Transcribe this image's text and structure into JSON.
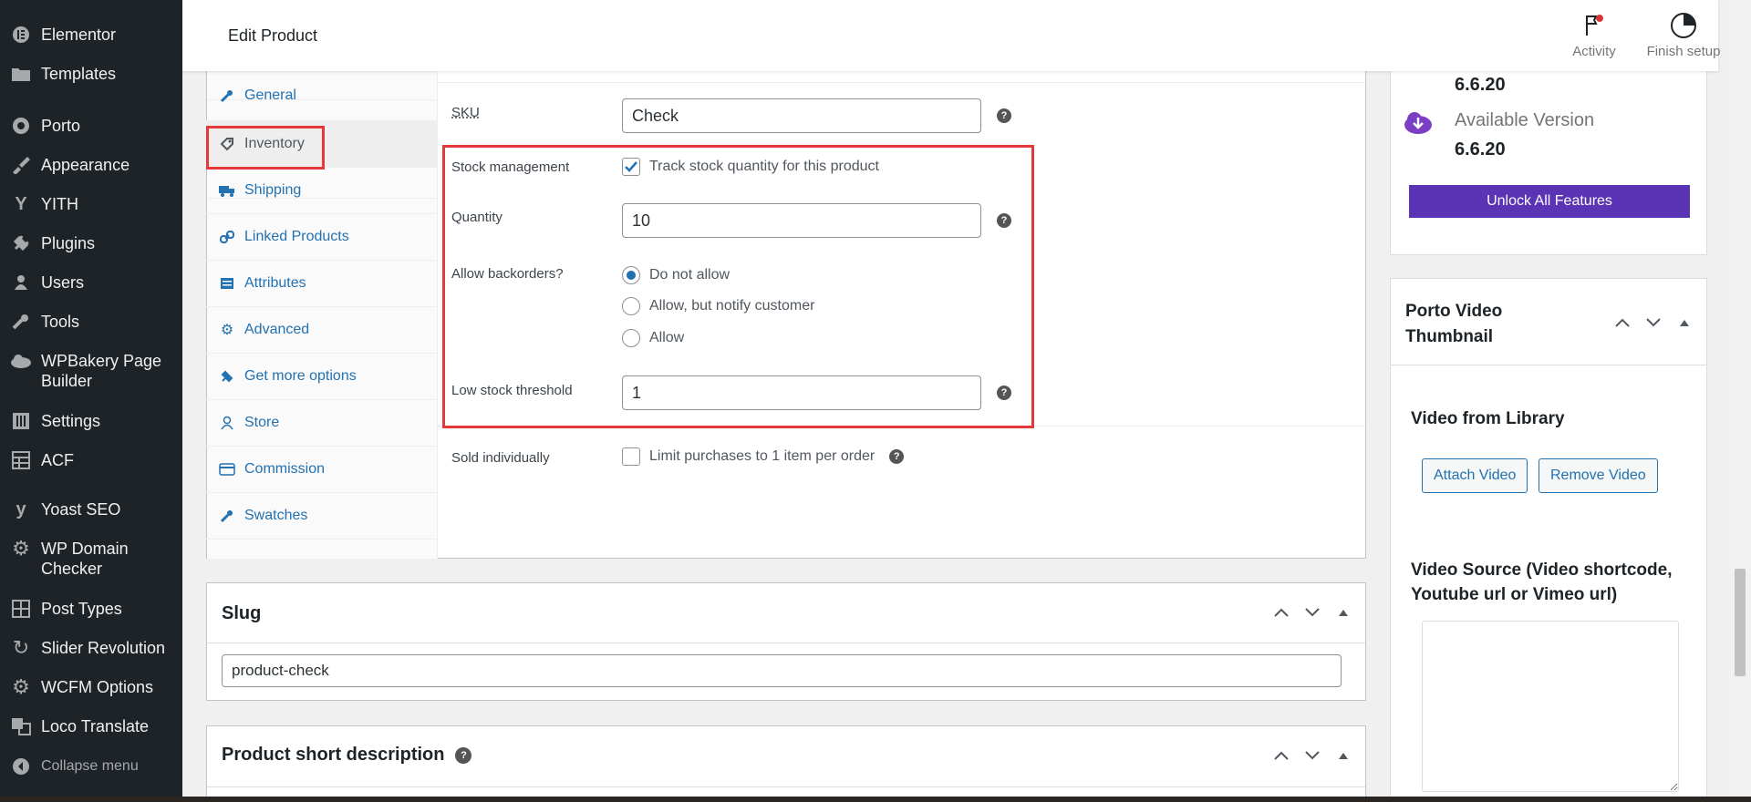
{
  "sidebar": {
    "items": [
      {
        "label": "Elementor",
        "icon": "elementor-icon"
      },
      {
        "label": "Templates",
        "icon": "folder-icon"
      },
      {
        "label": "Porto",
        "icon": "porto-icon"
      },
      {
        "label": "Appearance",
        "icon": "brush-icon"
      },
      {
        "label": "YITH",
        "icon": "yith-icon"
      },
      {
        "label": "Plugins",
        "icon": "plugin-icon"
      },
      {
        "label": "Users",
        "icon": "user-icon"
      },
      {
        "label": "Tools",
        "icon": "wrench-icon"
      },
      {
        "label": "WPBakery Page Builder",
        "icon": "cloud-icon"
      },
      {
        "label": "Settings",
        "icon": "settings-sliders-icon"
      },
      {
        "label": "ACF",
        "icon": "acf-grid-icon"
      },
      {
        "label": "Yoast SEO",
        "icon": "yoast-icon"
      },
      {
        "label": "WP Domain Checker",
        "icon": "gear-icon"
      },
      {
        "label": "Post Types",
        "icon": "grid-icon"
      },
      {
        "label": "Slider Revolution",
        "icon": "refresh-icon"
      },
      {
        "label": "WCFM Options",
        "icon": "gear-icon"
      },
      {
        "label": "Loco Translate",
        "icon": "translate-icon"
      }
    ],
    "collapse_label": "Collapse menu"
  },
  "header": {
    "title": "Edit Product",
    "activity_label": "Activity",
    "finish_setup_label": "Finish setup"
  },
  "product_data": {
    "tabs": [
      {
        "label": "General",
        "icon": "wrench-icon"
      },
      {
        "label": "Inventory",
        "icon": "tag-icon",
        "active": true
      },
      {
        "label": "Shipping",
        "icon": "truck-icon"
      },
      {
        "label": "Linked Products",
        "icon": "link-icon"
      },
      {
        "label": "Attributes",
        "icon": "list-icon"
      },
      {
        "label": "Advanced",
        "icon": "gear-icon"
      },
      {
        "label": "Get more options",
        "icon": "plug-icon"
      },
      {
        "label": "Store",
        "icon": "person-icon"
      },
      {
        "label": "Commission",
        "icon": "card-icon"
      },
      {
        "label": "Swatches",
        "icon": "wrench-icon"
      }
    ],
    "inventory": {
      "sku_label": "SKU",
      "sku_value": "Check",
      "stock_management_label": "Stock management",
      "stock_management_checkbox": "Track stock quantity for this product",
      "stock_management_checked": true,
      "quantity_label": "Quantity",
      "quantity_value": "10",
      "backorders_label": "Allow backorders?",
      "backorder_options": [
        "Do not allow",
        "Allow, but notify customer",
        "Allow"
      ],
      "backorder_selected": "Do not allow",
      "low_stock_label": "Low stock threshold",
      "low_stock_value": "1",
      "sold_individually_label": "Sold individually",
      "sold_individually_checkbox": "Limit purchases to 1 item per order",
      "sold_individually_checked": false
    }
  },
  "slug_box": {
    "title": "Slug",
    "value": "product-check"
  },
  "short_desc_box": {
    "title": "Product short description"
  },
  "version_box": {
    "current_version": "6.6.20",
    "available_label": "Available Version",
    "available_version": "6.6.20",
    "unlock_button": "Unlock All Features"
  },
  "video_box": {
    "title": "Porto Video Thumbnail",
    "library_label": "Video from Library",
    "attach_button": "Attach Video",
    "remove_button": "Remove Video",
    "source_label": "Video Source (Video shortcode, Youtube url or Vimeo url)"
  },
  "colors": {
    "sidebar_bg": "#1d2327",
    "link_blue": "#2271b1",
    "highlight_red": "#e5383b",
    "purple": "#5b34b5"
  }
}
